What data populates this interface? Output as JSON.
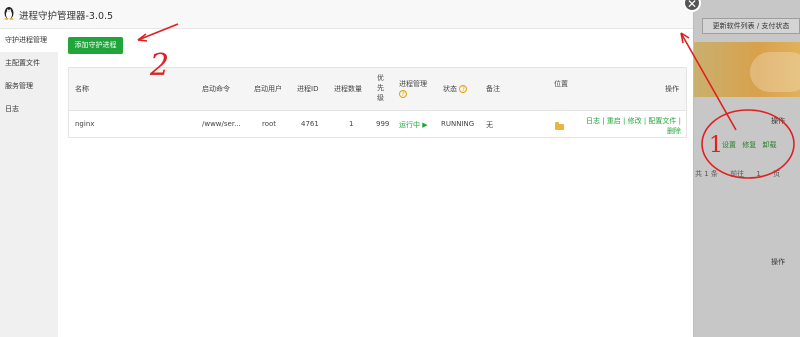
{
  "background": {
    "top_button": "更新软件列表 / 支付状态",
    "operation_label_1": "操作",
    "row_actions": [
      "设置",
      "修复",
      "卸载"
    ],
    "pager": [
      "共 1 条",
      "前往",
      "1",
      "页"
    ],
    "operation_label_2": "操作"
  },
  "modal": {
    "title": "进程守护管理器-3.0.5",
    "close_glyph": "✕",
    "sidebar": [
      {
        "label": "守护进程管理",
        "active": true
      },
      {
        "label": "主配置文件",
        "active": false
      },
      {
        "label": "服务管理",
        "active": false
      },
      {
        "label": "日志",
        "active": false
      }
    ],
    "add_button": "添加守护进程",
    "table": {
      "headers": {
        "name": "名称",
        "command": "启动命令",
        "user": "启动用户",
        "pid": "进程ID",
        "count": "进程数量",
        "priority": [
          "优",
          "先",
          "级"
        ],
        "manage": "进程管理",
        "status": "状态",
        "remark": "备注",
        "location": "位置",
        "ops": "操作"
      },
      "rows": [
        {
          "name": "nginx",
          "command": "/www/ser...",
          "user": "root",
          "pid": "4761",
          "count": "1",
          "priority": "999",
          "manage": "运行中",
          "status": "RUNNING",
          "remark": "无",
          "ops_line1": "日志 | 重启 | 修改 | 配置文件 |",
          "ops_line2": "删除"
        }
      ]
    }
  },
  "annotations": {
    "label_1": "1",
    "label_2": "2",
    "color": "#e02020"
  },
  "colors": {
    "accent_green": "#20a53a",
    "help_icon": "#e5a400",
    "folder": "#e9b53a"
  }
}
